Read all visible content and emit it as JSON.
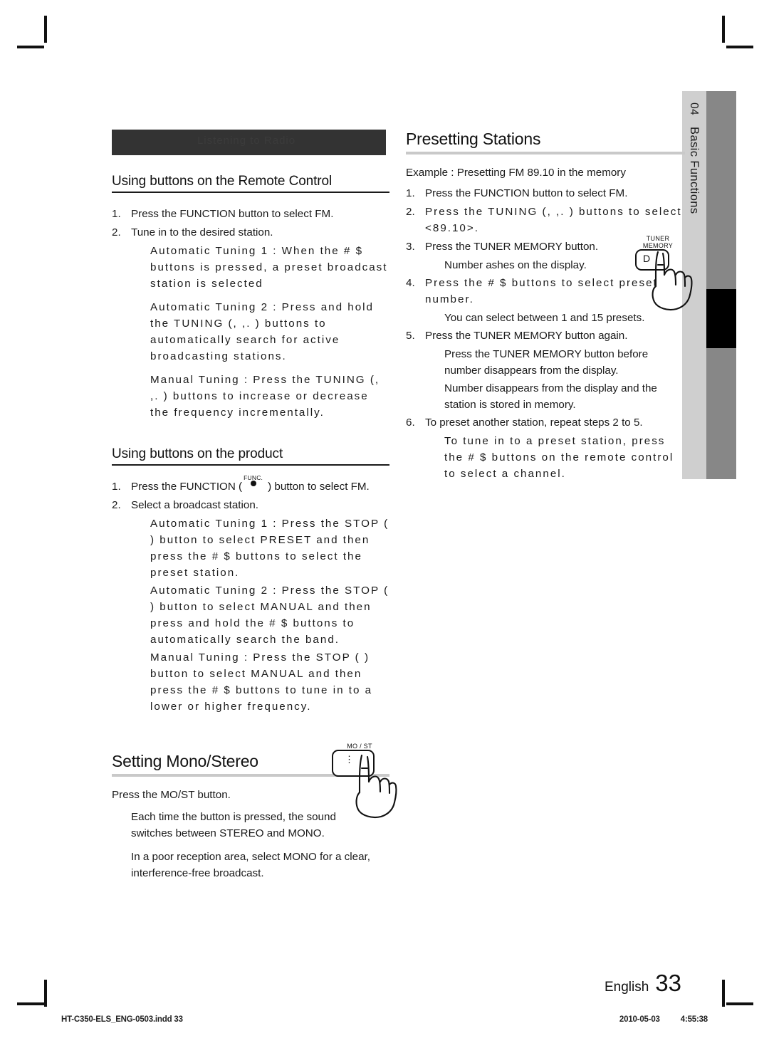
{
  "page": {
    "language": "English",
    "number": "33",
    "side_tab": {
      "chapter_number": "04",
      "chapter_title": "Basic Functions"
    },
    "dark_banner_ghost_text": "Listening to Radio"
  },
  "left_column": {
    "remote_heading": "Using buttons on the Remote Control",
    "remote_steps": [
      {
        "num": "1.",
        "text": "Press the FUNCTION button to select FM."
      },
      {
        "num": "2.",
        "text": "Tune in to the desired station."
      }
    ],
    "remote_notes": [
      "Automatic Tuning 1  : When the # $      buttons is pressed, a preset broadcast station is selected",
      "Automatic Tuning 2  : Press and hold the TUNING (,  ,.  ) buttons to automatically search for active broadcasting stations.",
      "Manual Tuning  : Press the TUNING (,  ,.  ) buttons to increase or decrease the frequency incrementally."
    ],
    "product_heading": "Using buttons on the product",
    "product_step1_pre": "Press the FUNCTION (",
    "product_step1_post": ") button to select FM.",
    "product_step1_num": "1.",
    "product_step2_num": "2.",
    "product_step2": "Select a broadcast station.",
    "product_notes": [
      "Automatic Tuning 1  : Press the STOP (    ) button to select PRESET and then press the  # $      buttons to select the preset station.",
      "Automatic Tuning 2  : Press the STOP (    ) button to select MANUAL and then press and hold the # $      buttons to automatically search the band.",
      "Manual Tuning  : Press the STOP (    ) button to select MANUAL and then press the # $ buttons to tune in to a lower or higher frequency."
    ],
    "mono_heading": "Setting Mono/Stereo",
    "mono_intro": "Press the MO/ST button.",
    "mono_notes": [
      "Each time the button is pressed, the sound switches between STEREO and MONO.",
      "In a poor reception area, select MONO for a clear, interference-free broadcast."
    ]
  },
  "right_column": {
    "heading": "Presetting Stations",
    "example": "Example : Presetting FM 89.10 in the memory",
    "steps": [
      {
        "num": "1.",
        "text": "Press the FUNCTION button to select FM."
      },
      {
        "num": "2.",
        "text": "Press the TUNING (,  ,.  ) buttons to select <89.10>."
      },
      {
        "num": "3.",
        "text": "Press the TUNER MEMORY button."
      },
      {
        "num": "4.",
        "text": "Press the # $      buttons to select preset number."
      },
      {
        "num": "5.",
        "text": "Press the TUNER MEMORY button again."
      },
      {
        "num": "6.",
        "text": "To preset another station, repeat steps 2 to 5."
      }
    ],
    "note_after_3": "Number  ashes on the display.",
    "note_after_4": "You can select between 1 and 15 presets.",
    "notes_after_5": [
      "Press the TUNER MEMORY button before number disappears from the display.",
      "Number disappears from the display and the station is stored in memory."
    ],
    "note_after_6": "To tune in to a preset station, press the # $ buttons on the remote control to select a channel."
  },
  "illustrations": {
    "tuner_memory": {
      "caption_line1": "TUNER",
      "caption_line2": "MEMORY",
      "button_label": "D"
    },
    "mo_st": {
      "caption": "MO / ST"
    },
    "function": {
      "caption": "FUNC."
    }
  },
  "print_footer": {
    "filename": "HT-C350-ELS_ENG-0503.indd   33",
    "date": "2010-05-03",
    "time": "4:55:38"
  }
}
